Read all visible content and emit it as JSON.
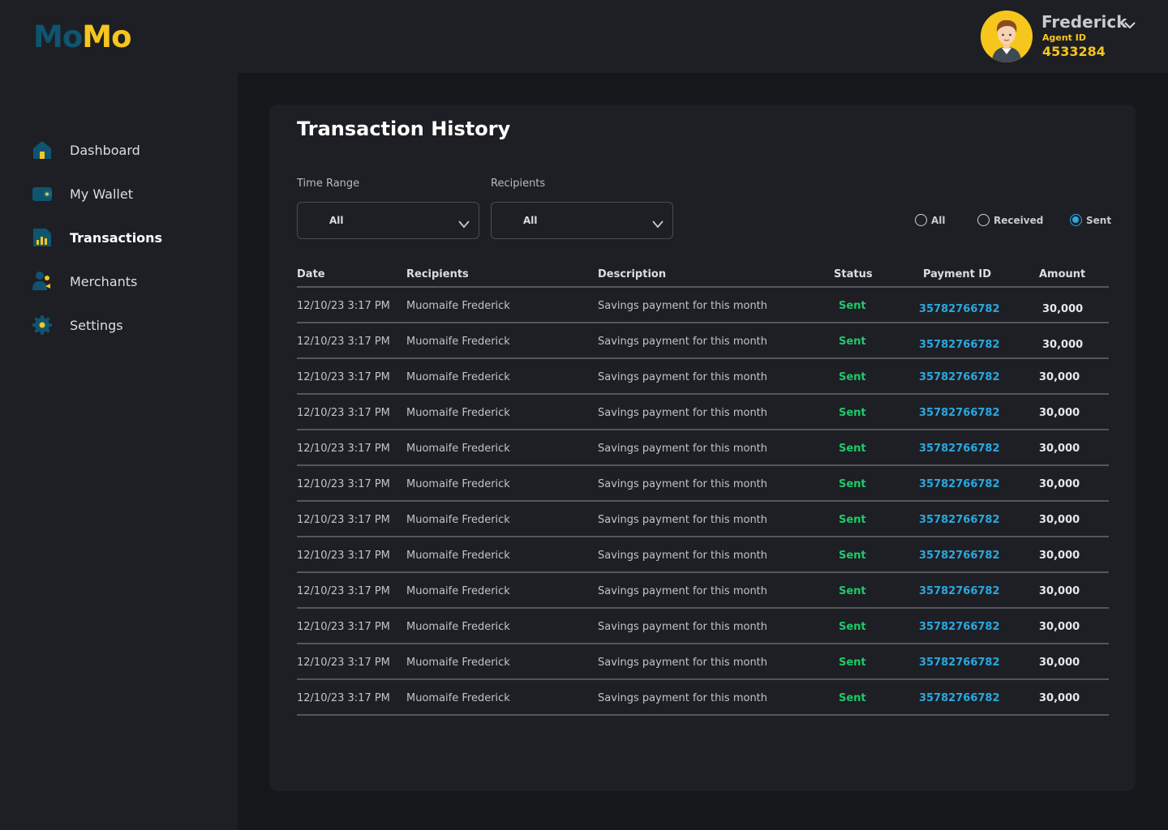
{
  "brand": {
    "part1": "Mo",
    "part2": "Mo"
  },
  "user": {
    "name": "Frederick",
    "agent_label": "Agent ID",
    "agent_id": "4533284"
  },
  "nav": [
    {
      "label": "Dashboard",
      "icon": "home-icon"
    },
    {
      "label": "My Wallet",
      "icon": "wallet-icon"
    },
    {
      "label": "Transactions",
      "icon": "transactions-icon",
      "active": true
    },
    {
      "label": "Merchants",
      "icon": "merchants-icon"
    },
    {
      "label": "Settings",
      "icon": "settings-icon"
    }
  ],
  "page": {
    "title": "Transaction History"
  },
  "filters": {
    "time_range_label": "Time Range",
    "time_range_value": "All",
    "recipients_label": "Recipients",
    "recipients_value": "All",
    "radio": [
      {
        "label": "All",
        "checked": false
      },
      {
        "label": "Received",
        "checked": false
      },
      {
        "label": "Sent",
        "checked": true
      }
    ]
  },
  "table": {
    "headers": {
      "date": "Date",
      "recipients": "Recipients",
      "description": "Description",
      "status": "Status",
      "payment_id": "Payment ID",
      "amount": "Amount"
    },
    "rows": [
      {
        "date": "12/10/23  3:17 PM",
        "recipient": "Muomaife Frederick",
        "description": "Savings payment for this month",
        "status": "Sent",
        "payment_id": "35782766782",
        "amount": "30,000"
      },
      {
        "date": "12/10/23  3:17 PM",
        "recipient": "Muomaife Frederick",
        "description": "Savings payment for this month",
        "status": "Sent",
        "payment_id": "35782766782",
        "amount": "30,000"
      },
      {
        "date": "12/10/23  3:17 PM",
        "recipient": "Muomaife Frederick",
        "description": "Savings payment for this month",
        "status": "Sent",
        "payment_id": "35782766782",
        "amount": "30,000"
      },
      {
        "date": "12/10/23  3:17 PM",
        "recipient": "Muomaife Frederick",
        "description": "Savings payment for this month",
        "status": "Sent",
        "payment_id": "35782766782",
        "amount": "30,000"
      },
      {
        "date": "12/10/23  3:17 PM",
        "recipient": "Muomaife Frederick",
        "description": "Savings payment for this month",
        "status": "Sent",
        "payment_id": "35782766782",
        "amount": "30,000"
      },
      {
        "date": "12/10/23  3:17 PM",
        "recipient": "Muomaife Frederick",
        "description": "Savings payment for this month",
        "status": "Sent",
        "payment_id": "35782766782",
        "amount": "30,000"
      },
      {
        "date": "12/10/23  3:17 PM",
        "recipient": "Muomaife Frederick",
        "description": "Savings payment for this month",
        "status": "Sent",
        "payment_id": "35782766782",
        "amount": "30,000"
      },
      {
        "date": "12/10/23  3:17 PM",
        "recipient": "Muomaife Frederick",
        "description": "Savings payment for this month",
        "status": "Sent",
        "payment_id": "35782766782",
        "amount": "30,000"
      },
      {
        "date": "12/10/23  3:17 PM",
        "recipient": "Muomaife Frederick",
        "description": "Savings payment for this month",
        "status": "Sent",
        "payment_id": "35782766782",
        "amount": "30,000"
      },
      {
        "date": "12/10/23  3:17 PM",
        "recipient": "Muomaife Frederick",
        "description": "Savings payment for this month",
        "status": "Sent",
        "payment_id": "35782766782",
        "amount": "30,000"
      },
      {
        "date": "12/10/23  3:17 PM",
        "recipient": "Muomaife Frederick",
        "description": "Savings payment for this month",
        "status": "Sent",
        "payment_id": "35782766782",
        "amount": "30,000"
      },
      {
        "date": "12/10/23  3:17 PM",
        "recipient": "Muomaife Frederick",
        "description": "Savings payment for this month",
        "status": "Sent",
        "payment_id": "35782766782",
        "amount": "30,000"
      }
    ]
  },
  "colors": {
    "brand_blue": "#0f5470",
    "brand_yellow": "#f6c61d",
    "status_sent": "#1fc96a",
    "link_blue": "#2aa8e0"
  }
}
